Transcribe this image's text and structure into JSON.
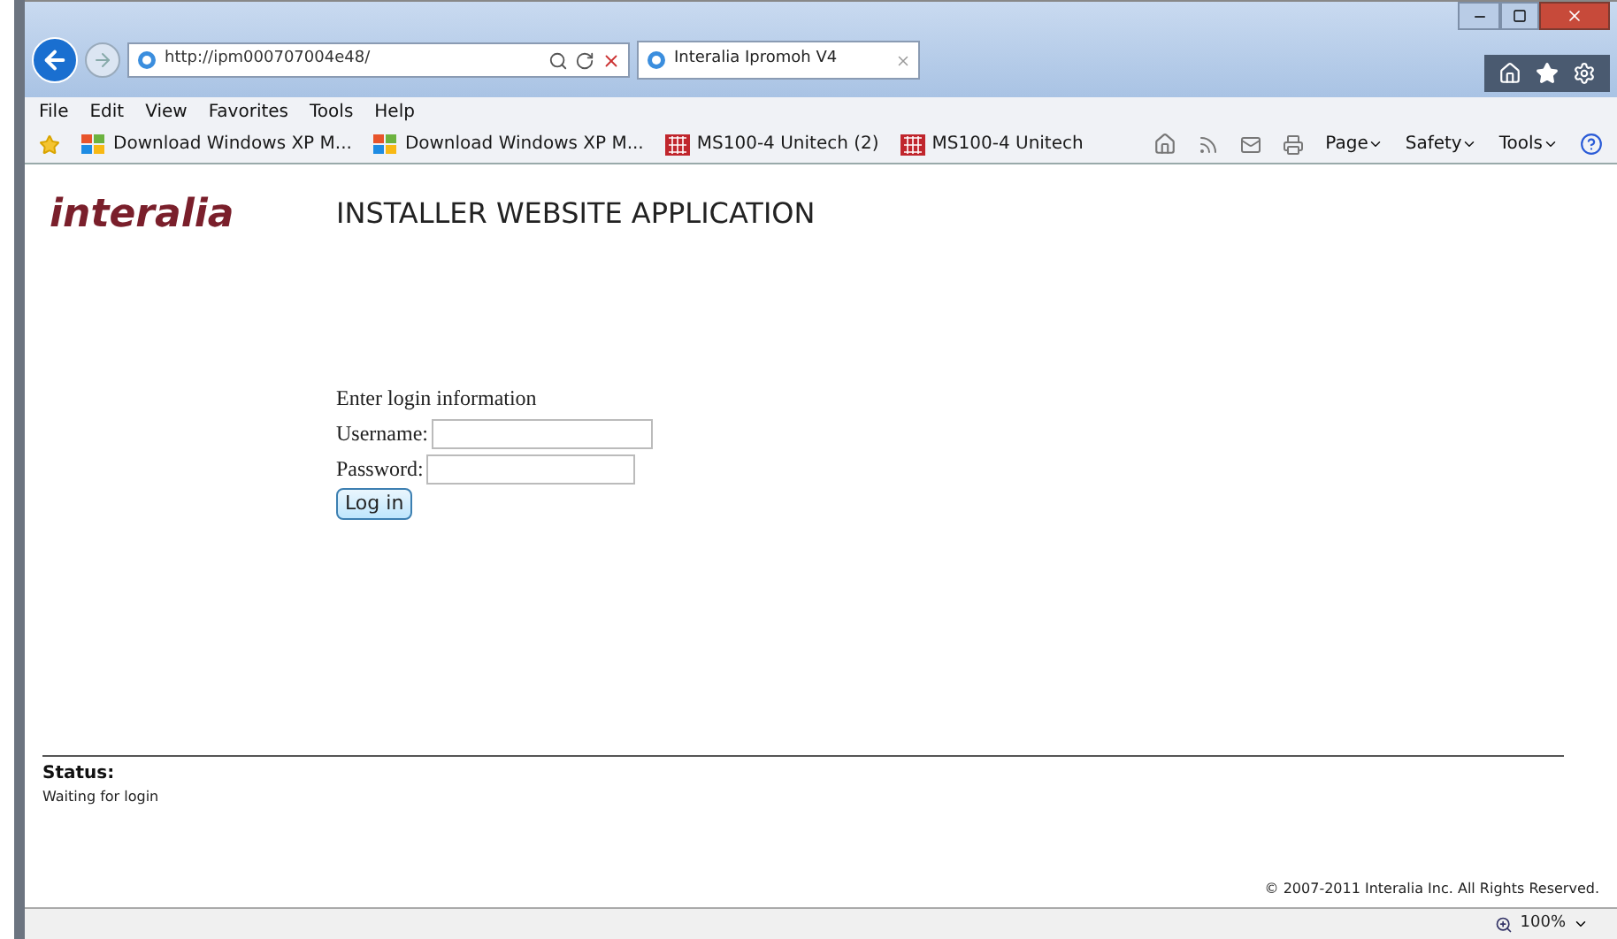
{
  "browser": {
    "address": "http://ipm000707004e48/",
    "tab": {
      "title": "Interalia Ipromoh V4",
      "selected": true
    },
    "menu": [
      "File",
      "Edit",
      "View",
      "Favorites",
      "Tools",
      "Help"
    ],
    "favorites": [
      {
        "kind": "windows",
        "label": "Download Windows XP M..."
      },
      {
        "kind": "windows",
        "label": "Download Windows XP M..."
      },
      {
        "kind": "unitech",
        "label": "MS100-4 Unitech (2)"
      },
      {
        "kind": "unitech",
        "label": "MS100-4 Unitech"
      }
    ],
    "commands": [
      "Page",
      "Safety",
      "Tools"
    ],
    "zoom": "100%"
  },
  "page": {
    "logo": "interalia",
    "heading": "INSTALLER WEBSITE APPLICATION",
    "login": {
      "prompt": "Enter login information",
      "fields": [
        {
          "label": "Username:"
        },
        {
          "label": "Password:"
        }
      ],
      "button": "Log in"
    },
    "status": {
      "label": "Status:",
      "message": "Waiting for login"
    },
    "copyright": "© 2007-2011 Interalia Inc. All Rights Reserved."
  }
}
